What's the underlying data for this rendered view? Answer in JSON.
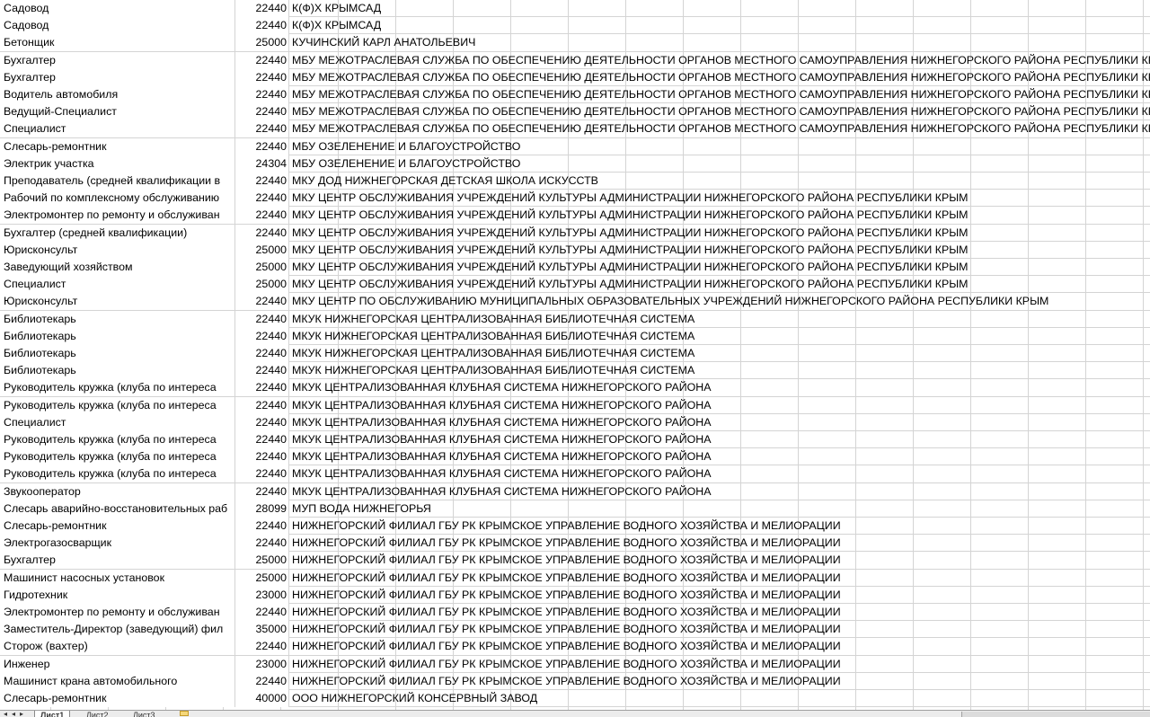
{
  "rows": [
    {
      "position": "Садовод",
      "salary": "22440",
      "employer": "К(Ф)Х КРЫМСАД"
    },
    {
      "position": "Садовод",
      "salary": "22440",
      "employer": "К(Ф)Х КРЫМСАД"
    },
    {
      "position": "Бетонщик",
      "salary": "25000",
      "employer": "КУЧИНСКИЙ  КАРЛ  АНАТОЛЬЕВИЧ"
    },
    {
      "position": "Бухгалтер",
      "salary": "22440",
      "employer": "МБУ МЕЖОТРАСЛЕВАЯ СЛУЖБА ПО ОБЕСПЕЧЕНИЮ ДЕЯТЕЛЬНОСТИ ОРГАНОВ МЕСТНОГО САМОУПРАВЛЕНИЯ НИЖНЕГОРСКОГО РАЙОНА РЕСПУБЛИКИ КРЫМ"
    },
    {
      "position": "Бухгалтер",
      "salary": "22440",
      "employer": "МБУ МЕЖОТРАСЛЕВАЯ СЛУЖБА ПО ОБЕСПЕЧЕНИЮ ДЕЯТЕЛЬНОСТИ ОРГАНОВ МЕСТНОГО САМОУПРАВЛЕНИЯ НИЖНЕГОРСКОГО РАЙОНА РЕСПУБЛИКИ КРЫМ"
    },
    {
      "position": "Водитель автомобиля",
      "salary": "22440",
      "employer": "МБУ МЕЖОТРАСЛЕВАЯ СЛУЖБА ПО ОБЕСПЕЧЕНИЮ ДЕЯТЕЛЬНОСТИ ОРГАНОВ МЕСТНОГО САМОУПРАВЛЕНИЯ НИЖНЕГОРСКОГО РАЙОНА РЕСПУБЛИКИ КРЫМ"
    },
    {
      "position": "Ведущий-Специалист",
      "salary": "22440",
      "employer": "МБУ МЕЖОТРАСЛЕВАЯ СЛУЖБА ПО ОБЕСПЕЧЕНИЮ ДЕЯТЕЛЬНОСТИ ОРГАНОВ МЕСТНОГО САМОУПРАВЛЕНИЯ НИЖНЕГОРСКОГО РАЙОНА РЕСПУБЛИКИ КРЫМ"
    },
    {
      "position": "Специалист",
      "salary": "22440",
      "employer": "МБУ МЕЖОТРАСЛЕВАЯ СЛУЖБА ПО ОБЕСПЕЧЕНИЮ ДЕЯТЕЛЬНОСТИ ОРГАНОВ МЕСТНОГО САМОУПРАВЛЕНИЯ НИЖНЕГОРСКОГО РАЙОНА РЕСПУБЛИКИ КРЫМ"
    },
    {
      "position": "Слесарь-ремонтник",
      "salary": "22440",
      "employer": "МБУ ОЗЕЛЕНЕНИЕ И БЛАГОУСТРОЙСТВО"
    },
    {
      "position": "Электрик участка",
      "salary": "24304",
      "employer": "МБУ ОЗЕЛЕНЕНИЕ И БЛАГОУСТРОЙСТВО"
    },
    {
      "position": "Преподаватель (средней квалификации в",
      "salary": "22440",
      "employer": "МКУ  ДОД  НИЖНЕГОРСКАЯ ДЕТСКАЯ ШКОЛА ИСКУССТВ"
    },
    {
      "position": "Рабочий по комплексному обслуживанию",
      "salary": "22440",
      "employer": "МКУ ЦЕНТР ОБСЛУЖИВАНИЯ УЧРЕЖДЕНИЙ КУЛЬТУРЫ АДМИНИСТРАЦИИ НИЖНЕГОРСКОГО РАЙОНА  РЕСПУБЛИКИ КРЫМ"
    },
    {
      "position": "Электромонтер по ремонту и обслуживан",
      "salary": "22440",
      "employer": "МКУ ЦЕНТР ОБСЛУЖИВАНИЯ УЧРЕЖДЕНИЙ КУЛЬТУРЫ АДМИНИСТРАЦИИ НИЖНЕГОРСКОГО РАЙОНА  РЕСПУБЛИКИ КРЫМ"
    },
    {
      "position": "Бухгалтер (средней квалификации)",
      "salary": "22440",
      "employer": "МКУ ЦЕНТР ОБСЛУЖИВАНИЯ УЧРЕЖДЕНИЙ КУЛЬТУРЫ АДМИНИСТРАЦИИ НИЖНЕГОРСКОГО РАЙОНА  РЕСПУБЛИКИ КРЫМ"
    },
    {
      "position": "Юрисконсульт",
      "salary": "25000",
      "employer": "МКУ ЦЕНТР ОБСЛУЖИВАНИЯ УЧРЕЖДЕНИЙ КУЛЬТУРЫ АДМИНИСТРАЦИИ НИЖНЕГОРСКОГО РАЙОНА  РЕСПУБЛИКИ КРЫМ"
    },
    {
      "position": "Заведующий хозяйством",
      "salary": "25000",
      "employer": "МКУ ЦЕНТР ОБСЛУЖИВАНИЯ УЧРЕЖДЕНИЙ КУЛЬТУРЫ АДМИНИСТРАЦИИ НИЖНЕГОРСКОГО РАЙОНА  РЕСПУБЛИКИ КРЫМ"
    },
    {
      "position": "Специалист",
      "salary": "25000",
      "employer": "МКУ ЦЕНТР ОБСЛУЖИВАНИЯ УЧРЕЖДЕНИЙ КУЛЬТУРЫ АДМИНИСТРАЦИИ НИЖНЕГОРСКОГО РАЙОНА  РЕСПУБЛИКИ КРЫМ"
    },
    {
      "position": "Юрисконсульт",
      "salary": "22440",
      "employer": "МКУ ЦЕНТР ПО ОБСЛУЖИВАНИЮ МУНИЦИПАЛЬНЫХ ОБРАЗОВАТЕЛЬНЫХ УЧРЕЖДЕНИЙ НИЖНЕГОРСКОГО РАЙОНА РЕСПУБЛИКИ КРЫМ"
    },
    {
      "position": "Библиотекарь",
      "salary": "22440",
      "employer": "МКУК НИЖНЕГОРСКАЯ ЦЕНТРАЛИЗОВАННАЯ БИБЛИОТЕЧНАЯ СИСТЕМА"
    },
    {
      "position": "Библиотекарь",
      "salary": "22440",
      "employer": "МКУК НИЖНЕГОРСКАЯ ЦЕНТРАЛИЗОВАННАЯ БИБЛИОТЕЧНАЯ СИСТЕМА"
    },
    {
      "position": "Библиотекарь",
      "salary": "22440",
      "employer": "МКУК НИЖНЕГОРСКАЯ ЦЕНТРАЛИЗОВАННАЯ БИБЛИОТЕЧНАЯ СИСТЕМА"
    },
    {
      "position": "Библиотекарь",
      "salary": "22440",
      "employer": "МКУК НИЖНЕГОРСКАЯ ЦЕНТРАЛИЗОВАННАЯ БИБЛИОТЕЧНАЯ СИСТЕМА"
    },
    {
      "position": "Руководитель кружка (клуба по интереса",
      "salary": "22440",
      "employer": "МКУК ЦЕНТРАЛИЗОВАННАЯ КЛУБНАЯ СИСТЕМА НИЖНЕГОРСКОГО РАЙОНА"
    },
    {
      "position": "Руководитель кружка (клуба по интереса",
      "salary": "22440",
      "employer": "МКУК ЦЕНТРАЛИЗОВАННАЯ КЛУБНАЯ СИСТЕМА НИЖНЕГОРСКОГО РАЙОНА"
    },
    {
      "position": "Специалист",
      "salary": "22440",
      "employer": "МКУК ЦЕНТРАЛИЗОВАННАЯ КЛУБНАЯ СИСТЕМА НИЖНЕГОРСКОГО РАЙОНА"
    },
    {
      "position": "Руководитель кружка (клуба по интереса",
      "salary": "22440",
      "employer": "МКУК ЦЕНТРАЛИЗОВАННАЯ КЛУБНАЯ СИСТЕМА НИЖНЕГОРСКОГО РАЙОНА"
    },
    {
      "position": "Руководитель кружка (клуба по интереса",
      "salary": "22440",
      "employer": "МКУК ЦЕНТРАЛИЗОВАННАЯ КЛУБНАЯ СИСТЕМА НИЖНЕГОРСКОГО РАЙОНА"
    },
    {
      "position": "Руководитель кружка (клуба по интереса",
      "salary": "22440",
      "employer": "МКУК ЦЕНТРАЛИЗОВАННАЯ КЛУБНАЯ СИСТЕМА НИЖНЕГОРСКОГО РАЙОНА"
    },
    {
      "position": "Звукооператор",
      "salary": "22440",
      "employer": "МКУК ЦЕНТРАЛИЗОВАННАЯ КЛУБНАЯ СИСТЕМА НИЖНЕГОРСКОГО РАЙОНА"
    },
    {
      "position": "Слесарь аварийно-восстановительных раб",
      "salary": "28099",
      "employer": "МУП ВОДА НИЖНЕГОРЬЯ"
    },
    {
      "position": "Слесарь-ремонтник",
      "salary": "22440",
      "employer": "НИЖНЕГОРСКИЙ ФИЛИАЛ ГБУ РК  КРЫМСКОЕ УПРАВЛЕНИЕ ВОДНОГО ХОЗЯЙСТВА И МЕЛИОРАЦИИ"
    },
    {
      "position": "Электрогазосварщик",
      "salary": "22440",
      "employer": "НИЖНЕГОРСКИЙ ФИЛИАЛ ГБУ РК  КРЫМСКОЕ УПРАВЛЕНИЕ ВОДНОГО ХОЗЯЙСТВА И МЕЛИОРАЦИИ"
    },
    {
      "position": "Бухгалтер",
      "salary": "25000",
      "employer": "НИЖНЕГОРСКИЙ ФИЛИАЛ ГБУ РК  КРЫМСКОЕ УПРАВЛЕНИЕ ВОДНОГО ХОЗЯЙСТВА И МЕЛИОРАЦИИ"
    },
    {
      "position": "Машинист насосных установок",
      "salary": "25000",
      "employer": "НИЖНЕГОРСКИЙ ФИЛИАЛ ГБУ РК  КРЫМСКОЕ УПРАВЛЕНИЕ ВОДНОГО ХОЗЯЙСТВА И МЕЛИОРАЦИИ"
    },
    {
      "position": "Гидротехник",
      "salary": "23000",
      "employer": "НИЖНЕГОРСКИЙ ФИЛИАЛ ГБУ РК  КРЫМСКОЕ УПРАВЛЕНИЕ ВОДНОГО ХОЗЯЙСТВА И МЕЛИОРАЦИИ"
    },
    {
      "position": "Электромонтер по ремонту и обслуживан",
      "salary": "22440",
      "employer": "НИЖНЕГОРСКИЙ ФИЛИАЛ ГБУ РК  КРЫМСКОЕ УПРАВЛЕНИЕ ВОДНОГО ХОЗЯЙСТВА И МЕЛИОРАЦИИ"
    },
    {
      "position": "Заместитель-Директор (заведующий) фил",
      "salary": "35000",
      "employer": "НИЖНЕГОРСКИЙ ФИЛИАЛ ГБУ РК  КРЫМСКОЕ УПРАВЛЕНИЕ ВОДНОГО ХОЗЯЙСТВА И МЕЛИОРАЦИИ"
    },
    {
      "position": "Сторож (вахтер)",
      "salary": "22440",
      "employer": "НИЖНЕГОРСКИЙ ФИЛИАЛ ГБУ РК  КРЫМСКОЕ УПРАВЛЕНИЕ ВОДНОГО ХОЗЯЙСТВА И МЕЛИОРАЦИИ"
    },
    {
      "position": "Инженер",
      "salary": "23000",
      "employer": "НИЖНЕГОРСКИЙ ФИЛИАЛ ГБУ РК  КРЫМСКОЕ УПРАВЛЕНИЕ ВОДНОГО ХОЗЯЙСТВА И МЕЛИОРАЦИИ"
    },
    {
      "position": "Машинист крана автомобильного",
      "salary": "22440",
      "employer": "НИЖНЕГОРСКИЙ ФИЛИАЛ ГБУ РК  КРЫМСКОЕ УПРАВЛЕНИЕ ВОДНОГО ХОЗЯЙСТВА И МЕЛИОРАЦИИ"
    },
    {
      "position": "Слесарь-ремонтник",
      "salary": "40000",
      "employer": "ООО НИЖНЕГОРСКИЙ КОНСЕРВНЫЙ ЗАВОД"
    }
  ],
  "tabs": {
    "sheet1": "Лист1",
    "sheet2": "Лист2",
    "sheet3": "Лист3"
  }
}
